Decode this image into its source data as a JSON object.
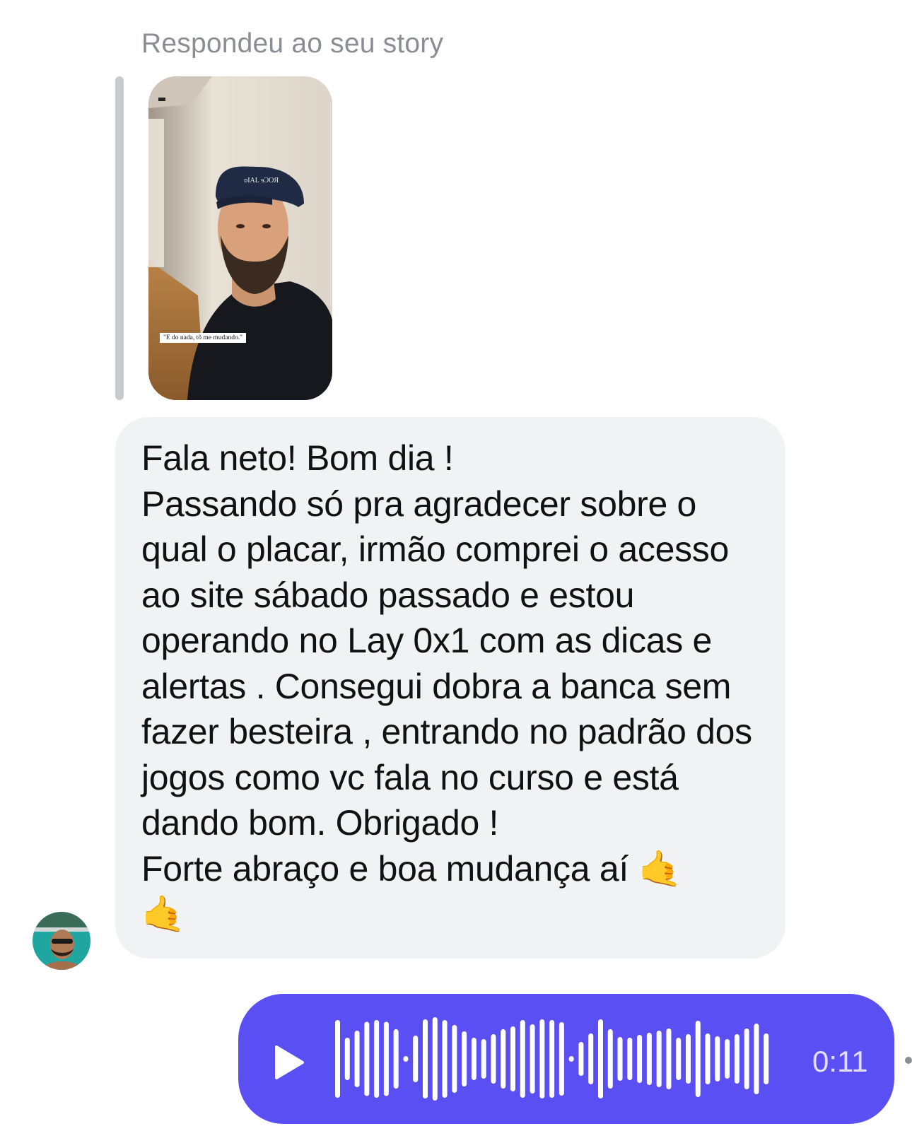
{
  "story_reply": {
    "caption": "Respondeu ao seu story",
    "overlay_text": "\"E do nada, tô me mudando.\""
  },
  "message": {
    "lines": [
      "Fala neto! Bom dia !",
      "Passando só pra agradecer sobre o qual o placar, irmão comprei o acesso ao site sábado passado e estou operando no Lay 0x1 com as dicas e alertas . Consegui dobra a banca sem fazer besteira , entrando no padrão dos jogos como vc fala no curso e está dando bom. Obrigado !",
      "Forte abraço e boa mudança aí"
    ],
    "emoji": "🤙",
    "emoji_icon": "call-me-hand-icon"
  },
  "voice_message": {
    "duration": "0:11",
    "bubble_color": "#5a4ff2"
  },
  "colors": {
    "received_bubble": "#f1f2f4",
    "caption_gray": "#8a8d93"
  }
}
